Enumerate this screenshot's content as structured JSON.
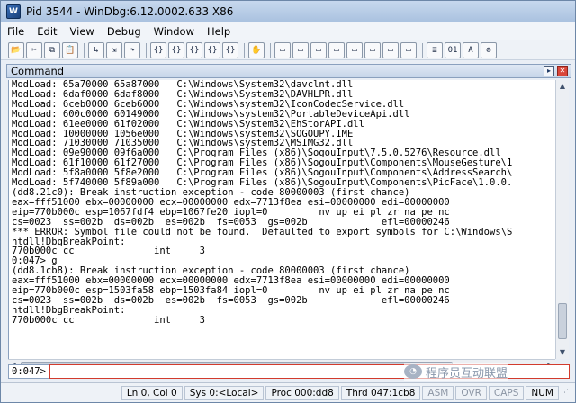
{
  "window": {
    "title": "Pid 3544 - WinDbg:6.12.0002.633 X86",
    "icon_text": "W"
  },
  "menu": [
    "File",
    "Edit",
    "View",
    "Debug",
    "Window",
    "Help"
  ],
  "toolbar": {
    "groups": [
      [
        {
          "icon": "open-icon",
          "glyph": "📂"
        },
        {
          "icon": "cut-icon",
          "glyph": "✂"
        },
        {
          "icon": "copy-icon",
          "glyph": "⧉"
        },
        {
          "icon": "paste-icon",
          "glyph": "📋"
        }
      ],
      [
        {
          "icon": "go-icon",
          "glyph": "↳"
        },
        {
          "icon": "step-into-icon",
          "glyph": "⇲"
        },
        {
          "icon": "step-over-icon",
          "glyph": "↷"
        }
      ],
      [
        {
          "icon": "step-out-icon",
          "glyph": "{}"
        },
        {
          "icon": "run-to-cursor-icon",
          "glyph": "{}"
        },
        {
          "icon": "trace-icon",
          "glyph": "{}"
        },
        {
          "icon": "break-icon",
          "glyph": "{}"
        },
        {
          "icon": "stop-icon",
          "glyph": "{}"
        }
      ],
      [
        {
          "icon": "hand-icon",
          "glyph": "✋"
        }
      ],
      [
        {
          "icon": "command-window-icon",
          "glyph": "▭"
        },
        {
          "icon": "watch-window-icon",
          "glyph": "▭"
        },
        {
          "icon": "locals-window-icon",
          "glyph": "▭"
        },
        {
          "icon": "registers-window-icon",
          "glyph": "▭"
        },
        {
          "icon": "memory-window-icon",
          "glyph": "▭"
        },
        {
          "icon": "callstack-window-icon",
          "glyph": "▭"
        },
        {
          "icon": "disassembly-window-icon",
          "glyph": "▭"
        },
        {
          "icon": "scratch-pad-icon",
          "glyph": "▭"
        }
      ],
      [
        {
          "icon": "source-mode-icon",
          "glyph": "≣"
        },
        {
          "icon": "hex-mode-icon",
          "glyph": "01"
        },
        {
          "icon": "font-icon",
          "glyph": "A"
        },
        {
          "icon": "options-icon",
          "glyph": "⚙"
        }
      ]
    ]
  },
  "command_pane": {
    "title": "Command",
    "lines": [
      "ModLoad: 65a70000 65a87000   C:\\Windows\\System32\\davclnt.dll",
      "ModLoad: 6daf0000 6daf8000   C:\\Windows\\System32\\DAVHLPR.dll",
      "ModLoad: 6ceb0000 6ceb6000   C:\\Windows\\system32\\IconCodecService.dll",
      "ModLoad: 600c0000 60149000   C:\\Windows\\system32\\PortableDeviceApi.dll",
      "ModLoad: 61ee0000 61f02000   C:\\Windows\\System32\\EhStorAPI.dll",
      "ModLoad: 10000000 1056e000   C:\\Windows\\system32\\SOGOUPY.IME",
      "ModLoad: 71030000 71035000   C:\\Windows\\system32\\MSIMG32.dll",
      "ModLoad: 09e90000 09f6a000   C:\\Program Files (x86)\\SogouInput\\7.5.0.5276\\Resource.dll",
      "ModLoad: 61f10000 61f27000   C:\\Program Files (x86)\\SogouInput\\Components\\MouseGesture\\1",
      "ModLoad: 5f8a0000 5f8e2000   C:\\Program Files (x86)\\SogouInput\\Components\\AddressSearch\\",
      "ModLoad: 5f740000 5f89a000   C:\\Program Files (x86)\\SogouInput\\Components\\PicFace\\1.0.0.",
      "(dd8.21c0): Break instruction exception - code 80000003 (first chance)",
      "eax=fff51000 ebx=00000000 ecx=00000000 edx=7713f8ea esi=00000000 edi=00000000",
      "eip=770b000c esp=1067fdf4 ebp=1067fe20 iopl=0         nv up ei pl zr na pe nc",
      "cs=0023  ss=002b  ds=002b  es=002b  fs=0053  gs=002b             efl=00000246",
      "*** ERROR: Symbol file could not be found.  Defaulted to export symbols for C:\\Windows\\S",
      "ntdll!DbgBreakPoint:",
      "770b000c cc              int     3",
      "0:047> g",
      "(dd8.1cb8): Break instruction exception - code 80000003 (first chance)",
      "eax=fff51000 ebx=00000000 ecx=00000000 edx=7713f8ea esi=00000000 edi=00000000",
      "eip=770b000c esp=1503fa58 ebp=1503fa84 iopl=0         nv up ei pl zr na pe nc",
      "cs=0023  ss=002b  ds=002b  es=002b  fs=0053  gs=002b             efl=00000246",
      "ntdll!DbgBreakPoint:",
      "770b000c cc              int     3"
    ],
    "prompt": "0:047>",
    "input_value": ""
  },
  "watermark": {
    "text": "程序员互动联盟"
  },
  "status": [
    {
      "name": "status-line-col",
      "text": "Ln 0, Col 0",
      "dim": false
    },
    {
      "name": "status-sys",
      "text": "Sys 0:<Local>",
      "dim": false
    },
    {
      "name": "status-proc",
      "text": "Proc 000:dd8",
      "dim": false
    },
    {
      "name": "status-thrd",
      "text": "Thrd 047:1cb8",
      "dim": false
    },
    {
      "name": "status-asm",
      "text": "ASM",
      "dim": true
    },
    {
      "name": "status-ovr",
      "text": "OVR",
      "dim": true
    },
    {
      "name": "status-caps",
      "text": "CAPS",
      "dim": true
    },
    {
      "name": "status-num",
      "text": "NUM",
      "dim": false
    }
  ]
}
